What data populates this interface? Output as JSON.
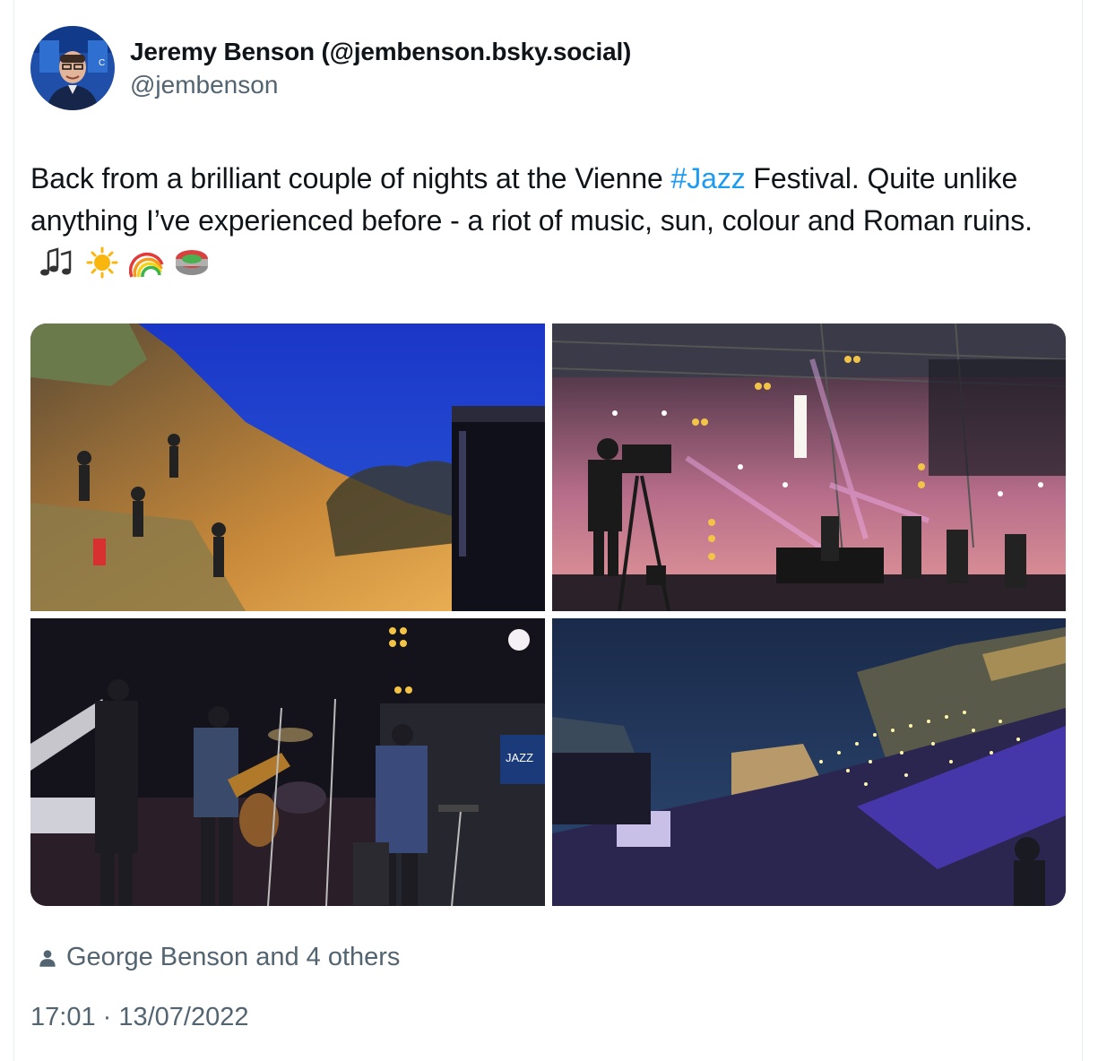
{
  "tweet": {
    "author_name": "Jeremy Benson (@jembenson.bsky.social)",
    "author_handle": "@jembenson",
    "text_before_hashtag": "Back from a brilliant couple of nights at the Vienne ",
    "hashtag": "#Jazz",
    "text_after_hashtag": " Festival. Quite unlike anything I’ve experienced before - a riot of music, sun, colour and Roman ruins.",
    "emojis": [
      "musical-notes-emoji",
      "sun-emoji",
      "rainbow-emoji",
      "stadium-emoji"
    ],
    "tagged_people": "George Benson and 4 others",
    "timestamp": "17:01 · 13/07/2022"
  },
  "media": [
    {
      "description_name": "amphitheatre-crowd-dusk-photo"
    },
    {
      "description_name": "stage-camera-operator-photo"
    },
    {
      "description_name": "band-on-stage-photo"
    },
    {
      "description_name": "amphitheatre-night-crowd-photo"
    }
  ],
  "colors": {
    "hashtag": "#1d9bf0",
    "secondary_text": "#536471",
    "primary_text": "#0f1419"
  }
}
